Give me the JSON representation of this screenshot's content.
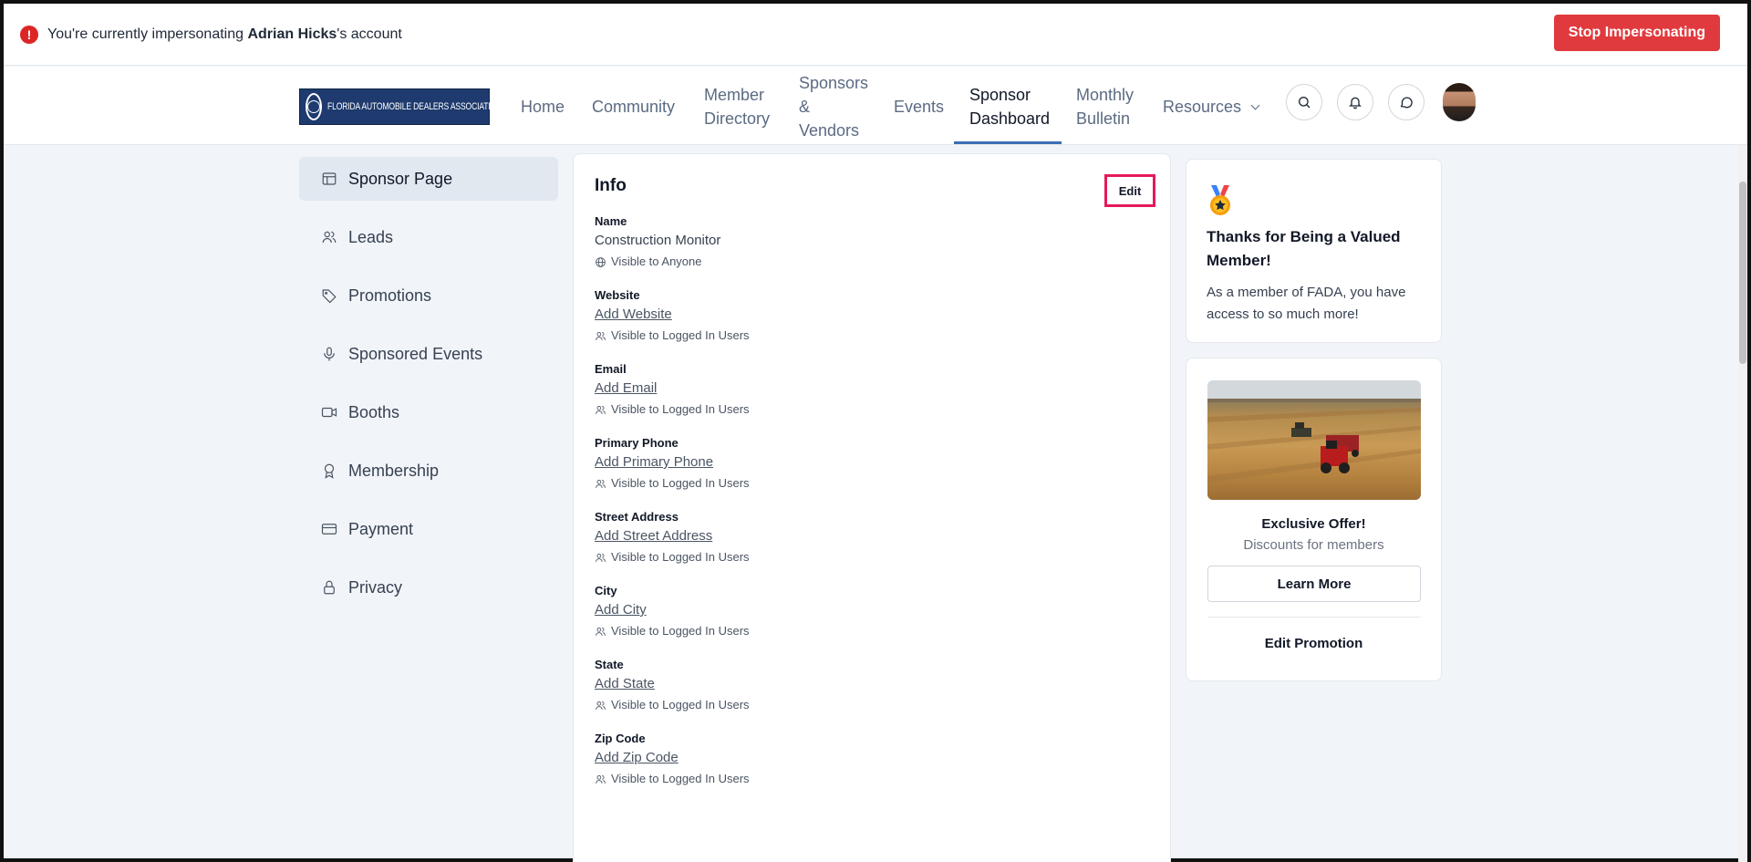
{
  "banner": {
    "prefix": "You're currently impersonating ",
    "user": "Adrian Hicks",
    "suffix": "'s account",
    "stop_label": "Stop Impersonating"
  },
  "logo": {
    "text": "FLORIDA AUTOMOBILE DEALERS ASSOCIATION"
  },
  "nav": {
    "home": "Home",
    "community": "Community",
    "member_line1": "Member",
    "member_line2": "Directory",
    "sponsors_line1": "Sponsors",
    "sponsors_line2": "&",
    "sponsors_line3": "Vendors",
    "events": "Events",
    "dashboard_line1": "Sponsor",
    "dashboard_line2": "Dashboard",
    "bulletin_line1": "Monthly",
    "bulletin_line2": "Bulletin",
    "resources": "Resources"
  },
  "sidebar": {
    "items": [
      {
        "label": "Sponsor Page"
      },
      {
        "label": "Leads"
      },
      {
        "label": "Promotions"
      },
      {
        "label": "Sponsored Events"
      },
      {
        "label": "Booths"
      },
      {
        "label": "Membership"
      },
      {
        "label": "Payment"
      },
      {
        "label": "Privacy"
      }
    ]
  },
  "info": {
    "title": "Info",
    "edit_label": "Edit",
    "fields": [
      {
        "label": "Name",
        "value": "Construction Monitor",
        "visibility": "Visible to Anyone"
      },
      {
        "label": "Website",
        "value": "Add Website",
        "visibility": "Visible to Logged In Users"
      },
      {
        "label": "Email",
        "value": "Add Email",
        "visibility": "Visible to Logged In Users"
      },
      {
        "label": "Primary Phone",
        "value": "Add Primary Phone",
        "visibility": "Visible to Logged In Users"
      },
      {
        "label": "Street Address",
        "value": "Add Street Address",
        "visibility": "Visible to Logged In Users"
      },
      {
        "label": "City",
        "value": "Add City",
        "visibility": "Visible to Logged In Users"
      },
      {
        "label": "State",
        "value": "Add State",
        "visibility": "Visible to Logged In Users"
      },
      {
        "label": "Zip Code",
        "value": "Add Zip Code",
        "visibility": "Visible to Logged In Users"
      }
    ]
  },
  "member_card": {
    "title": "Thanks for Being a Valued Member!",
    "text": "As a member of FADA, you have access to so much more!"
  },
  "promo": {
    "title": "Exclusive Offer!",
    "subtitle": "Discounts for members",
    "learn_label": "Learn More",
    "edit_label": "Edit Promotion"
  },
  "colors": {
    "accent": "#3b6fb6",
    "danger": "#e03a3e",
    "highlight": "#e6195a"
  }
}
